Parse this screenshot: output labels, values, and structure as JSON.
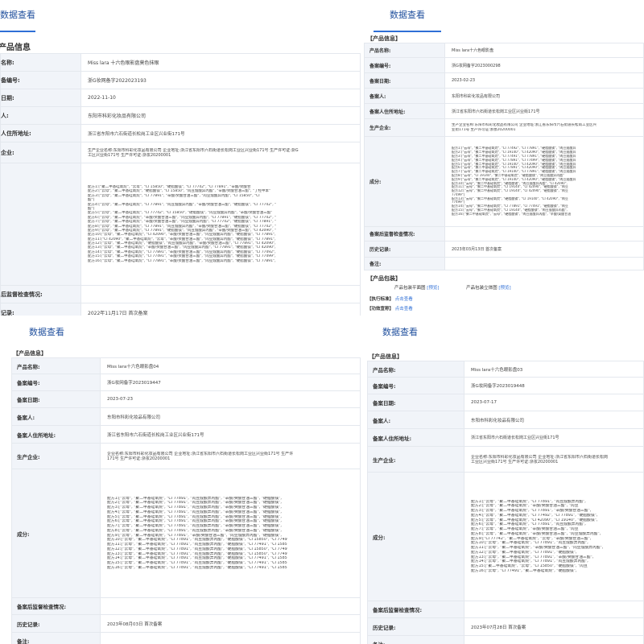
{
  "panels": [
    {
      "tab": "数据查看",
      "section": "产品信息",
      "rows": {
        "name": {
          "label": "名称:",
          "value": "Miss lara 十六色眼影盘莫色抹眼"
        },
        "reg_no": {
          "label": "备编号:",
          "value": "浙G妆网备字2022023193"
        },
        "reg_date": {
          "label": "日期:",
          "value": "2022-11-10"
        },
        "filer": {
          "label": "人:",
          "value": "东阳市科彩化妆品有限公司"
        },
        "addr": {
          "label": "人住所地址:",
          "value": "浙江省东阳市六石街道长松岗工业区兴业街171号"
        },
        "producer": {
          "label": "企业:",
          "lines": [
            "生产企业名称:东阳市科彩化妆品有限公司 企业地址:浙江省东阳市六石街道长松岗工业区兴业街171号 生产许可证:浙G",
            "工区兴业街171号 生产许可证:浙妆20200001"
          ]
        },
        "ingredients": {
          "lines": [
            "配方1:[\"聚二甲基硅氧烷\", \"云母\", \"CI 15850\", \"硬脂酸镁\", \"CI 77742\", \"CI 77891\", \"辛酸/癸酸甘",
            "配方2:[\"云母\", \"聚二甲基硅氧烷\", \"硬脂酸镁\", \"CI 15850\", \"肉豆蔻酸异丙酯\", \"辛酸/癸酸甘油三酯\", \"丁羟甲苯\"",
            "配方3:[\"云母\", \"聚二甲基硅氧烷\", \"CI 77891\", \"辛酸/癸酸甘油三酯\", \"肉豆蔻酸异丙酯\", \"CI 15850\", \"CI",
            "酯\"]",
            "配方4:[\"云母\", \"聚二甲基硅氧烷\", \"CI 77891\", \"肉豆蔻酸异丙酯\", \"辛酸/癸酸甘油三酯\", \"硬脂酸镁\", \"CI 77742\", \"",
            "酯\"]",
            "配方5:[\"云母\", \"聚二甲基硅氧烷\", \"CI 77742\", \"CI 15850\", \"硬脂酸镁\", \"肉豆蔻酸异丙酯\", \"辛酸/癸酸甘油三酯\"",
            "配方6:[\"云母\", \"聚二甲基硅氧烷\", \"辛酸/癸酸甘油三酯\", \"肉豆蔻酸异丙酯\", \"CI 77891\", \"硬脂酸镁\", \"CI 77742\", \"",
            "配方7:[\"云母\", \"聚二甲基硅氧烷\", \"辛酸/癸酸甘油三酯\", \"肉豆蔻酸异丙酯\", \"CI 77742\", \"硬脂酸镁\", \"CI 77891\", \"",
            "配方8:[\"云母\", \"聚二甲基硅氧烷\", \"CI 77891\", \"肉豆蔻酸异丙酯\", \"辛酸/癸酸甘油三酯\", \"硬脂酸镁\", \"CI 77742\", \"",
            "配方9:[\"云母\", \"聚二甲基硅氧烷\", \"CI 77891\", \"硬脂酸镁\", \"肉豆蔻酸异丙酯\", \"辛酸/癸酸甘油三酯\", \"CI 42090\", \"",
            "配方10:[\"云母\", \"聚二甲基硅氧烷\", \"CI 42090\", \"辛酸/癸酸甘油三酯\", \"肉豆蔻酸异丙酯\", \"硬脂酸镁\", \"CI 77891\",",
            "配方11:[\"CI 42090\", \"聚二甲基硅氧烷\", \"云母\", \"辛酸/癸酸甘油三酯\", \"肉豆蔻酸异丙酯\", \"硬脂酸镁\", \"CI 77891\",",
            "配方12:[\"云母\", \"聚二甲基硅氧烷\", \"硬脂酸镁\", \"肉豆蔻酸异丙酯\", \"辛酸/癸酸甘油三酯\", \"CI 77891\", \"CI 42090\",",
            "配方13:[\"云母\", \"聚二甲基硅氧烷\", \"辛酸/癸酸甘油三酯\", \"肉豆蔻酸异丙酯\", \"CI 77891\", \"硬脂酸镁\", \"CI 42090\",",
            "配方14:[\"云母\", \"聚二甲基硅氧烷\", \"CI 77891\", \"辛酸/癸酸甘油三酯\", \"肉豆蔻酸异丙酯\", \"硬脂酸镁\", \"CI 77492\",",
            "配方15:[\"云母\", \"聚二甲基硅氧烷\", \"CI 77491\", \"辛酸/癸酸甘油三酯\", \"肉豆蔻酸异丙酯\", \"硬脂酸镁\", \"CI 77499\",",
            "配方16:[\"云母\", \"聚二甲基硅氧烷\", \"CI 77891\", \"辛酸/癸酸甘油三酯\", \"肉豆蔻酸异丙酯\", \"硬脂酸镁\", \"CI 77891\","
          ]
        },
        "post": {
          "label": "后监督检查情况:",
          "value": ""
        },
        "history": {
          "label": "记录:",
          "value": "2022年11月17日 首次备案"
        }
      }
    },
    {
      "tab": "数据查看",
      "section": "产品信息",
      "rows": {
        "name": {
          "label": "产品名称:",
          "value": "Miss lara十六色眼影盘"
        },
        "reg_no": {
          "label": "备案编号:",
          "value": "浙G妆网备字2023000298"
        },
        "reg_date": {
          "label": "备案日期:",
          "value": "2023-02-23"
        },
        "filer": {
          "label": "备案人:",
          "value": "东阳市科彩化妆品有限公司"
        },
        "addr": {
          "label": "备案人住所地址:",
          "value": "浙江省东阳市六石街道长松岗工业区兴业街171号"
        },
        "producer": {
          "label": "生产企业:",
          "lines": [
            "生产企业名称:东阳市科彩化妆品有限公司 企业地址:浙江省东阳市六石街道长松岗工业区兴",
            "业街171号 生产许可证:浙妆20200001"
          ]
        },
        "ingredients": {
          "label": "成分:",
          "lines": [
            "配方1:[\"云母\", \"聚二甲基硅氧烷\", \"CI 77492\", \"CI 77891\", \"硬脂酸镁\", \"肉豆蔻酸异",
            "配方2:[\"云母\", \"聚二甲基硅氧烷\", \"CI 19140\", \"CI 42090\", \"硬脂酸镁\", \"肉豆蔻酸异",
            "配方3:[\"云母\", \"聚二甲基硅氧烷\", \"CI 77491\", \"CI 77891\", \"硬脂酸镁\", \"肉豆蔻酸异",
            "配方4:[\"云母\", \"聚二甲基硅氧烷\", \"CI 77891\", \"CI 77499\", \"硬脂酸镁\", \"肉豆蔻酸异",
            "配方5:[\"云母\", \"聚二甲基硅氧烷\", \"CI 19140\", \"CI 42090\", \"硬脂酸镁\", \"肉豆蔻酸异",
            "配方6:[\"云母\", \"聚二甲基硅氧烷\", \"CI 77891\", \"CI 42090\", \"硬脂酸镁\", \"肉豆蔻酸异",
            "配方7:[\"云母\", \"聚二甲基硅氧烷\", \"CI 19140\", \"CI 77891\", \"硬脂酸镁\", \"肉豆蔻酸异",
            "配方8:[\"云母\", \"CI 19140\", \"聚二甲基硅氧烷\", \"硬脂酸镁\", \"肉豆蔻酸异丙酯\"",
            "配方9:[\"云母\", \"聚二甲基硅氧烷\", \"CI 19140\", \"CI 42090\", \"硬脂酸镁\", \"肉豆蔻酸异",
            "配方10:[\"云母\", \"聚二甲基硅氧烷\", \"硬脂酸镁\", \"肉豆蔻酸异丙酯\", \"CI 42090\",",
            "配方11:[\"云母\", \"聚二甲基硅氧烷\", \"CI 19140\", \"CI 42090\", \"硬脂酸镁\", \"肉豆",
            "配方12:[\"云母\", \"聚二甲基硅氧烷\", \"CI 19140\", \"CI 42090\", \"硬脂酸镁\", \"肉豆",
            "77499\"]",
            "配方13:[\"云母\", \"聚二甲基硅氧烷\", \"硬脂酸镁\", \"CI 19140\", \"CI 42090\", \"肉豆",
            "77499\"]",
            "配方14:[\"云母\", \"聚二甲基硅氧烷\", \"CI 77891\", \"CI 77491\", \"硬脂酸镁\", \"肉豆",
            "配方15:[\"云母\", \"聚二甲基硅氧烷\", \"CI 19140\", \"硬脂酸镁\", \"肉豆蔻酸异丙酯\",",
            "配方16:[\"聚二甲基硅氧烷\", \"云母\", \"硬脂酸镁\", \"肉豆蔻酸异丙酯\", \"辛酸/癸酸甘油"
          ]
        },
        "post": {
          "label": "备案后监督检查情况:",
          "value": ""
        },
        "history": {
          "label": "历史记录:",
          "value": "2023年03月13日 首次备案"
        },
        "note": {
          "label": "备注:",
          "value": ""
        }
      },
      "package_section": "产品包装",
      "package": {
        "plane": "产品包装平面图",
        "plane_link": "[预览]",
        "stereo": "产品包装立体图",
        "stereo_link": "[预览]"
      },
      "standard_section": "执行标准",
      "standard_link": "点击查看",
      "efficacy_section": "功效宣称",
      "efficacy_link": "点击查看"
    },
    {
      "tab": "数据查看",
      "section": "产品信息",
      "rows": {
        "name": {
          "label": "产品名称:",
          "value": "Miss lara十六色眼影盘04"
        },
        "reg_no": {
          "label": "备案编号:",
          "value": "浙G妆网备字2023019447"
        },
        "reg_date": {
          "label": "备案日期:",
          "value": "2023-07-23"
        },
        "filer": {
          "label": "备案人:",
          "value": "东阳市科彩化妆品有限公司"
        },
        "addr": {
          "label": "备案人住所地址:",
          "value": "浙江省东阳市六石街道长松岗工业区兴业街171号"
        },
        "producer": {
          "label": "生产企业:",
          "lines": [
            "企业名称:东阳市科彩化妆品有限公司 企业地址:浙江省东阳市六石街道长松岗工业区兴业街171号 生产许",
            "171号 生产许可证:浙妆20200001"
          ]
        },
        "ingredients": {
          "label": "成分:",
          "lines": [
            "配方1:[\"云母\", \"聚二甲基硅氧烷\", \"CI 77891\", \"肉豆蔻酸异丙酯\", \"辛酸/癸酸甘油三酯\", \"硬脂酸镁\",",
            "配方2:[\"云母\", \"聚二甲基硅氧烷\", \"CI 77891\", \"肉豆蔻酸异丙酯\", \"辛酸/癸酸甘油三酯\", \"硬脂酸镁\",",
            "配方3:[\"云母\", \"聚二甲基硅氧烷\", \"CI 77891\", \"肉豆蔻酸异丙酯\", \"辛酸/癸酸甘油三酯\", \"硬脂酸镁\",",
            "配方4:[\"云母\", \"聚二甲基硅氧烷\", \"CI 77891\", \"肉豆蔻酸异丙酯\", \"辛酸/癸酸甘油三酯\", \"硬脂酸镁\",",
            "配方5:[\"云母\", \"聚二甲基硅氧烷\", \"CI 77891\", \"肉豆蔻酸异丙酯\", \"辛酸/癸酸甘油三酯\", \"硬脂酸镁\",",
            "配方6:[\"云母\", \"聚二甲基硅氧烷\", \"CI 77891\", \"肉豆蔻酸异丙酯\", \"辛酸/癸酸甘油三酯\", \"硬脂酸镁\",",
            "配方7:[\"云母\", \"聚二甲基硅氧烷\", \"CI 77891\", \"肉豆蔻酸异丙酯\", \"辛酸/癸酸甘油三酯\", \"硬脂酸镁\",",
            "配方8:[\"云母\", \"聚二甲基硅氧烷\", \"CI 77891\", \"肉豆蔻酸异丙酯\", \"辛酸/癸酸甘油三酯\", \"硬脂酸镁\",",
            "配方9:[\"云母\", \"聚二甲基硅氧烷\", \"CI 77891\", \"辛酸/癸酸甘油三酯\", \"肉豆蔻酸异丙酯\", \"硬脂酸镁\",",
            "配方10:[\"云母\", \"聚二甲基硅氧烷\", \"CI 77891\", \"肉豆蔻酸异丙酯\", \"硬脂酸镁\", \"CI 15850\", \"CI 7749",
            "配方11:[\"云母\", \"聚二甲基硅氧烷\", \"CI 77891\", \"肉豆蔻酸异丙酯\", \"硬脂酸镁\", \"CI 77491\", \"CI 1585",
            "配方12:[\"云母\", \"聚二甲基硅氧烷\", \"CI 77891\", \"肉豆蔻酸异丙酯\", \"硬脂酸镁\", \"CI 15850\", \"CI 7749",
            "配方13:[\"云母\", \"聚二甲基硅氧烷\", \"CI 77891\", \"肉豆蔻酸异丙酯\", \"硬脂酸镁\", \"CI 15850\", \"CI 7749",
            "配方14:[\"云母\", \"聚二甲基硅氧烷\", \"CI 77891\", \"肉豆蔻酸异丙酯\", \"硬脂酸镁\", \"CI 77491\", \"CI 1585",
            "配方15:[\"云母\", \"聚二甲基硅氧烷\", \"CI 77891\", \"肉豆蔻酸异丙酯\", \"硬脂酸镁\", \"CI 77491\", \"CI 1585",
            "配方16:[\"云母\", \"聚二甲基硅氧烷\", \"CI 77891\", \"肉豆蔻酸异丙酯\", \"硬脂酸镁\", \"CI 77491\", \"CI 1585"
          ]
        },
        "post": {
          "label": "备案后监督检查情况:",
          "value": ""
        },
        "history": {
          "label": "历史记录:",
          "value": "2023年08月03日 首次备案"
        },
        "note": {
          "label": "备注:",
          "value": ""
        }
      }
    },
    {
      "tab": "数据查看",
      "section": "产品信息",
      "rows": {
        "name": {
          "label": "产品名称:",
          "value": "Miss lara十六色眼影盘03"
        },
        "reg_no": {
          "label": "备案编号:",
          "value": "浙G妆网备字2023019448"
        },
        "reg_date": {
          "label": "备案日期:",
          "value": "2023-07-17"
        },
        "filer": {
          "label": "备案人:",
          "value": "东阳市科彩化妆品有限公司"
        },
        "addr": {
          "label": "备案人住所地址:",
          "value": "浙江省东阳市六石街道长松岗工业区兴业街171号"
        },
        "producer": {
          "label": "生产企业:",
          "lines": [
            "企业名称:东阳市科彩化妆品有限公司 企业地址:浙江省东阳市六石街道长松岗",
            "工业区兴业街171号 生产许可证:浙妆20200001"
          ]
        },
        "ingredients": {
          "label": "成分:",
          "lines": [
            "配方1:[\"云母\", \"聚二甲基硅氧烷\", \"CI 77891\", \"肉豆蔻酸异丙酯\",",
            "配方2:[\"云母\", \"聚二甲基硅氧烷\", \"辛酸/癸酸甘油三酯\", \"肉豆",
            "配方3:[\"云母\", \"聚二甲基硅氧烷\", \"CI 77891\", \"辛酸/癸酸甘油三酯\",",
            "配方4:[\"云母\", \"聚二甲基硅氧烷\", \"CI 77492\", \"CI 77891\", \"硬脂酸镁\",",
            "配方5:[\"云母\", \"聚二甲基硅氧烷\", \"CI 42090\", \"CI 19140\", \"硬脂酸镁\",",
            "配方6:[\"云母\", \"聚二甲基硅氧烷\", \"CI 77891\", \"肉豆蔻酸异丙酯\",",
            "配方7:[\"云母\", \"聚二甲基硅氧烷\", \"辛酸/癸酸甘油三酯\", \"肉豆",
            "配方8:[\"云母\", \"聚二甲基硅氧烷\", \"辛酸/癸酸甘油三酯\", \"肉豆蔻酸异丙酯\",",
            "配方9:[\"CI 77742\", \"聚二甲基硅氧烷\", \"云母\", \"辛酸/癸酸甘油三酯\",",
            "配方10:[\"云母\", \"聚二甲基硅氧烷\", \"CI 77891\", \"肉豆蔻酸异丙酯\",",
            "配方11:[\"云母\", \"聚二甲基硅氧烷\", \"辛酸/癸酸甘油三酯\", \"肉豆蔻酸异丙酯\",",
            "配方12:[\"云母\", \"聚二甲基硅氧烷\", \"CI 77891\", \"硬脂酸镁\",",
            "配方13:[\"云母\", \"聚二甲基硅氧烷\", \"CI 77891\", \"辛酸/癸酸甘油三酯\",",
            "配方14:[\"云母\", \"聚二甲基硅氧烷\", \"CI 77891\", \"肉豆蔻酸异丙酯\",",
            "配方15:[\"聚二甲基硅氧烷\", \"云母\", \"CI 15850\", \"硬脂酸镁\", \"肉豆",
            "配方16:[\"云母\", \"CI 77491\", \"聚二甲基硅氧烷\", \"硬脂酸镁\","
          ]
        },
        "post": {
          "label": "备案后监督检查情况:",
          "value": ""
        },
        "history": {
          "label": "历史记录:",
          "value": "2023年07月28日 首次备案"
        },
        "note": {
          "label": "备注:",
          "value": ""
        }
      }
    }
  ]
}
